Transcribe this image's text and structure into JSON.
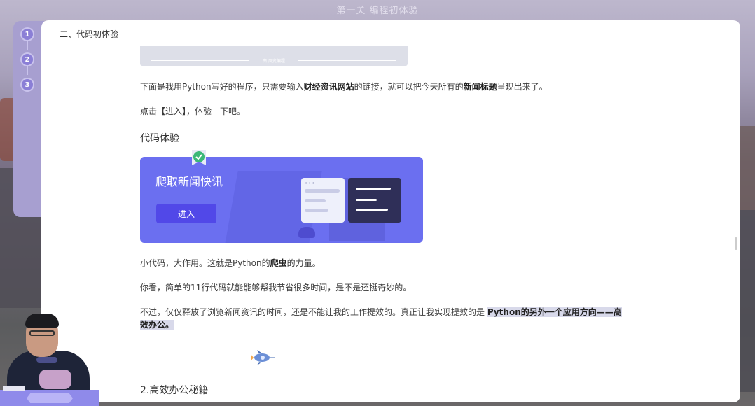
{
  "window": {
    "title": "第一关 编程初体验"
  },
  "steps": [
    "1",
    "2",
    "3"
  ],
  "section": {
    "heading": "二、代码初体验"
  },
  "image_strip": {
    "caption": "由 风变编程"
  },
  "intro": {
    "before": "下面是我用Python写好的程序，只需要输入",
    "bold1": "财经资讯网站",
    "middle": "的链接，就可以把今天所有的",
    "bold2": "新闻标题",
    "after": "呈现出来了。"
  },
  "prompt_text": "点击【进入】，体验一下吧。",
  "code_section": {
    "heading": "代码体验",
    "card_title": "爬取新闻快讯",
    "enter_label": "进入",
    "window_dots": "•••"
  },
  "para1": {
    "before": "小代码，大作用。这就是Python的",
    "bold": "爬虫",
    "after": "的力量。"
  },
  "para2": "你看，简单的11行代码就能能够帮我节省很多时间，是不是还挺奇妙的。",
  "para3": {
    "before": "不过，仅仅释放了浏览新闻资讯的时间，还是不能让我的工作提效的。真正让我实现提效的是 ",
    "highlight1": "Python的另外一个应用方向——高",
    "highlight2": "效办公。"
  },
  "next_heading": "2.高效办公秘籍",
  "colors": {
    "accent": "#6b6ff0",
    "button": "#5148e8",
    "step": "#8b7fd6",
    "badge": "#3cb878"
  },
  "icons": [
    "check-badge-icon",
    "rocket-icon",
    "mouse-icon"
  ]
}
